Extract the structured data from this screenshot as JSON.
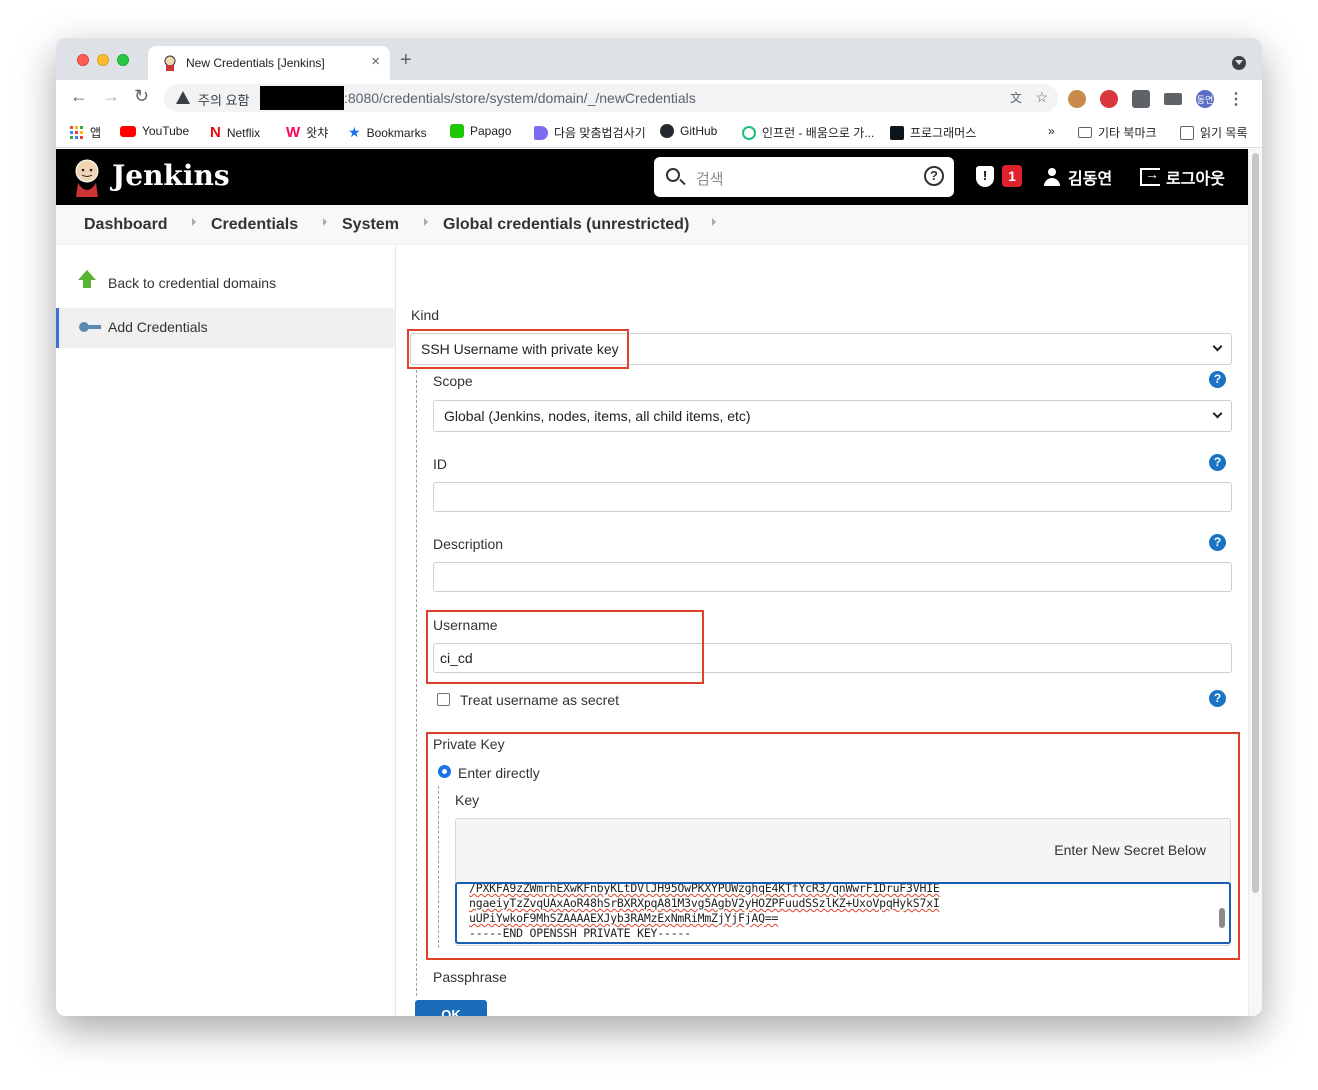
{
  "browser": {
    "tab_title": "New Credentials [Jenkins]",
    "tab_close": "×",
    "new_tab": "+",
    "security_label": "주의 요함",
    "url": ":8080/credentials/store/system/domain/_/newCredentials",
    "profile_initials": "동연"
  },
  "bookmarks": {
    "items": [
      {
        "label": "앱",
        "icon": "apps-grid-icon"
      },
      {
        "label": "YouTube",
        "icon": "youtube-icon"
      },
      {
        "label": "Netflix",
        "icon": "netflix-icon"
      },
      {
        "label": "왓챠",
        "icon": "watcha-icon"
      },
      {
        "label": "Bookmarks",
        "icon": "star-icon"
      },
      {
        "label": "Papago",
        "icon": "papago-icon"
      },
      {
        "label": "다음 맞춤법검사기",
        "icon": "daum-icon"
      },
      {
        "label": "GitHub",
        "icon": "github-icon"
      },
      {
        "label": "인프런 - 배움으로 가...",
        "icon": "inflearn-icon"
      },
      {
        "label": "프로그래머스",
        "icon": "programmers-icon"
      }
    ],
    "overflow": "»",
    "other": "기타 북마크",
    "reading_list": "읽기 목록"
  },
  "jenkins": {
    "title": "Jenkins",
    "search_placeholder": "검색",
    "help_glyph": "?",
    "alert_count": "1",
    "user_name": "김동연",
    "logout_label": "로그아웃"
  },
  "breadcrumbs": [
    "Dashboard",
    "Credentials",
    "System",
    "Global credentials (unrestricted)"
  ],
  "sidebar": {
    "items": [
      {
        "label": "Back to credential domains",
        "icon": "arrow-up-icon"
      },
      {
        "label": "Add Credentials",
        "icon": "key-icon"
      }
    ]
  },
  "form": {
    "kind_label": "Kind",
    "kind_value": "SSH Username with private key",
    "scope_label": "Scope",
    "scope_value": "Global (Jenkins, nodes, items, all child items, etc)",
    "id_label": "ID",
    "id_value": "",
    "description_label": "Description",
    "description_value": "",
    "username_label": "Username",
    "username_value": "ci_cd",
    "treat_secret_label": "Treat username as secret",
    "private_key_label": "Private Key",
    "enter_directly_label": "Enter directly",
    "key_label": "Key",
    "secret_placeholder": "Enter New Secret Below",
    "key_lines": [
      "/PXKFA9zZWmrhEXwKFnbyKLtDVlJH95OwPKXYPUWzghqE4KTfYcR3/qnWwrF1DruF3VHIE",
      "ngaeiyTzZvqUAxAoR48hSrBXRXpqA81M3vg5AgbV2yHOZPFuudSSzlKZ+UxoVpqHykS7xI",
      "uUPiYwkoF9MhSZAAAAEXJyb3RAMzExNmRiMmZjYjFjAQ==",
      "-----END OPENSSH PRIVATE KEY-----"
    ],
    "passphrase_label": "Passphrase",
    "ok_label": "OK",
    "help_glyph": "?"
  },
  "colors": {
    "highlight": "#e0412a",
    "help": "#1a73c4",
    "ok_button": "#1a6bb8",
    "active_border": "#3a6fd8"
  }
}
